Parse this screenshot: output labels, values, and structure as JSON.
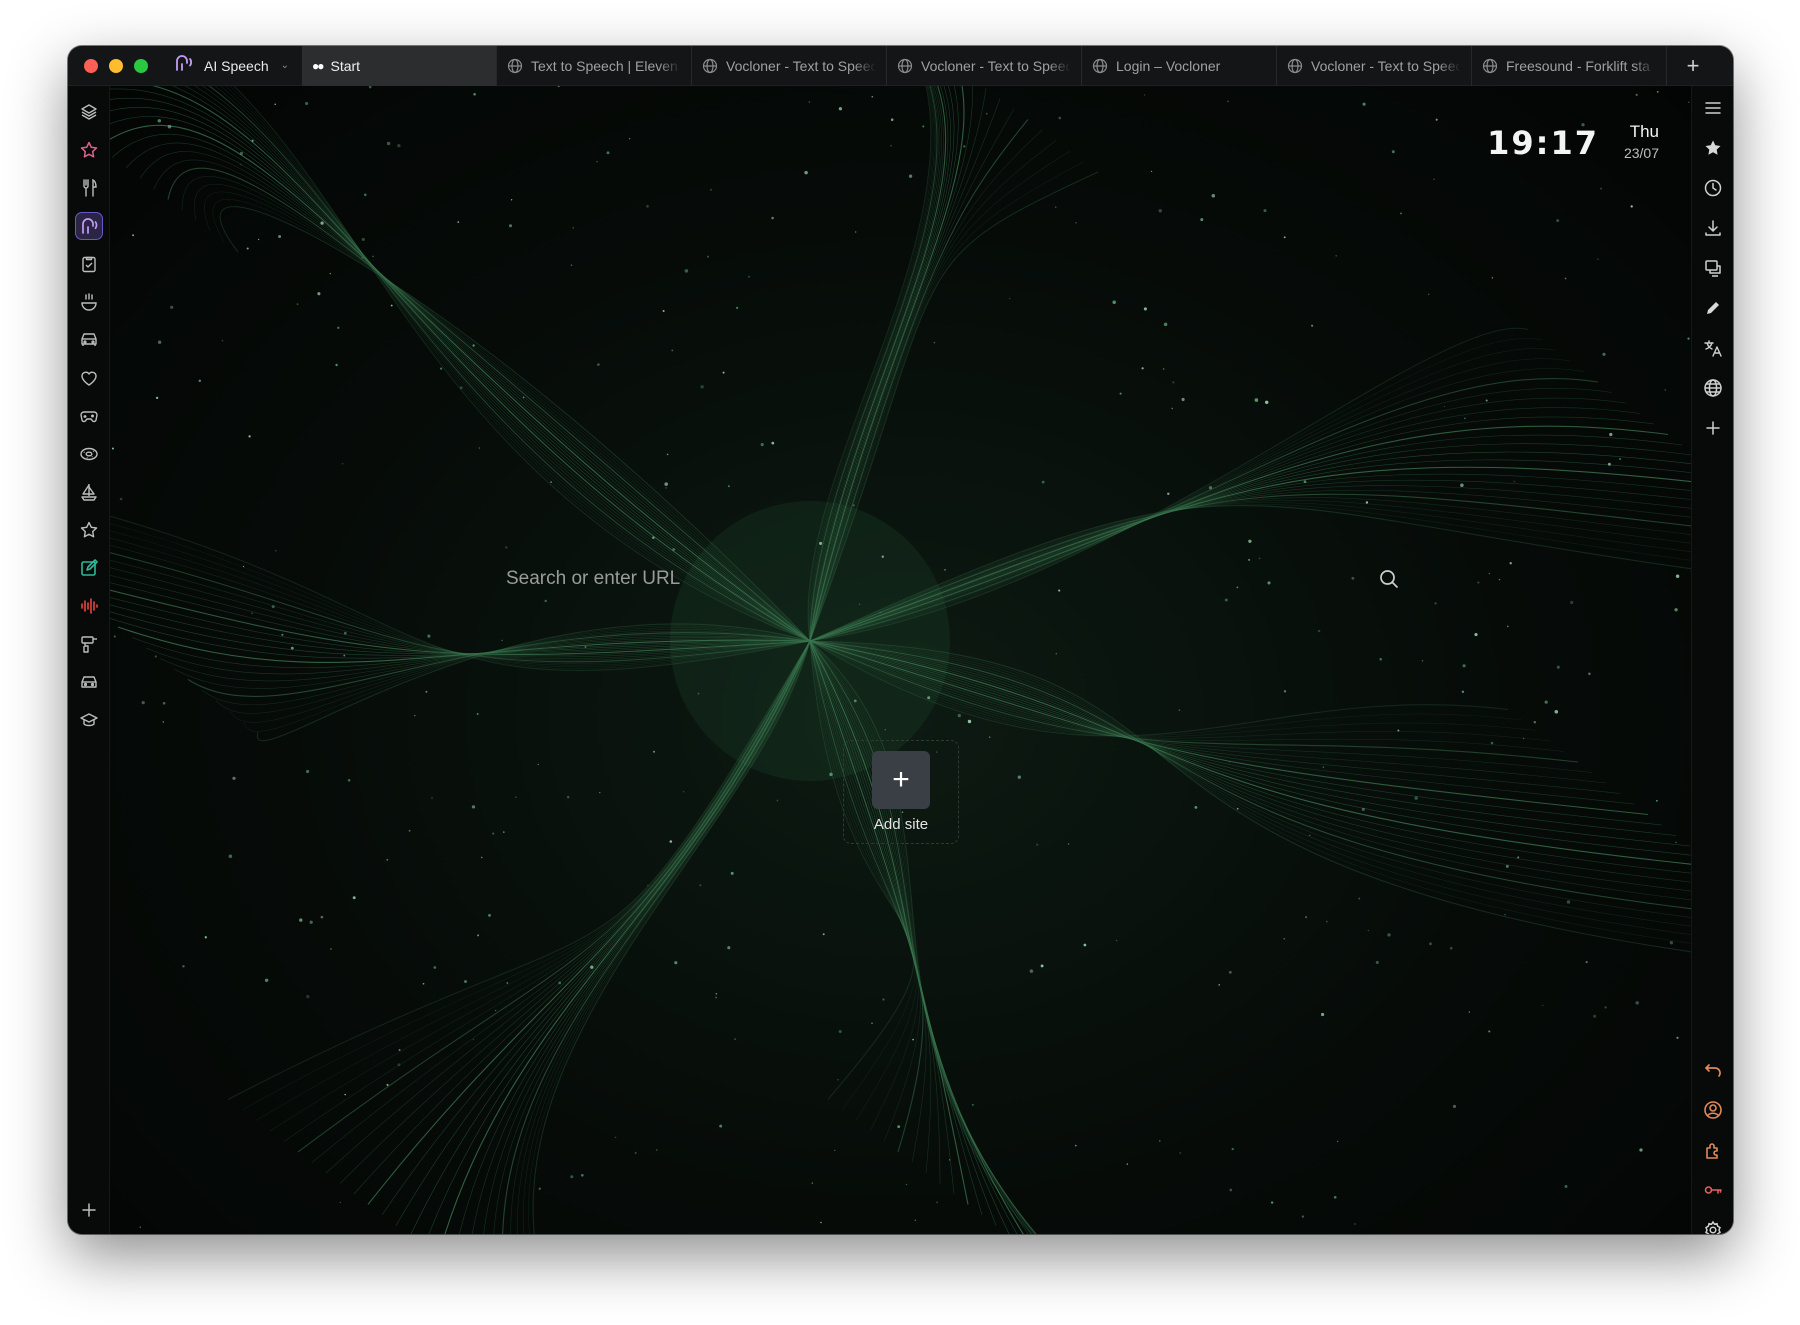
{
  "workspace": {
    "name": "AI Speech"
  },
  "tabs": [
    {
      "label": "Start",
      "active": true,
      "icon": "mask-icon"
    },
    {
      "label": "Text to Speech | Eleven",
      "icon": "globe-icon"
    },
    {
      "label": "Vocloner - Text to Speech",
      "icon": "globe-icon"
    },
    {
      "label": "Vocloner - Text to Speech",
      "icon": "globe-icon"
    },
    {
      "label": "Login – Vocloner",
      "icon": "globe-icon"
    },
    {
      "label": "Vocloner - Text to Speech",
      "icon": "globe-icon"
    },
    {
      "label": "Freesound - Forklift sta",
      "icon": "globe-icon"
    }
  ],
  "clock": {
    "time": "19:17",
    "day": "Thu",
    "date": "23/07"
  },
  "search": {
    "placeholder": "Search or enter URL"
  },
  "speed_dial": {
    "add_label": "Add site"
  },
  "left_sidebar": [
    "layers-icon",
    "star-icon",
    "cutlery-icon",
    "ai-speech-icon",
    "clipboard-check-icon",
    "steaming-bowl-icon",
    "car-icon",
    "heart-icon",
    "gamepad-icon",
    "donut-icon",
    "sailboat-icon",
    "star-outline-icon",
    "edit-square-icon",
    "audio-wave-icon",
    "drill-icon",
    "car-front-icon",
    "graduation-cap-icon",
    "add-panel-icon"
  ],
  "right_sidebar": [
    "menu-icon",
    "bookmark-star-icon",
    "history-icon",
    "download-icon",
    "snapshot-icon",
    "pencil-icon",
    "translate-icon",
    "globe-icon",
    "add-icon",
    "undo-icon",
    "account-icon",
    "extensions-icon",
    "key-icon",
    "settings-icon"
  ],
  "colors": {
    "accent_purple": "#c59cf5",
    "accent_green": "#2fb89a",
    "accent_red": "#e8453c",
    "accent_orange": "#e08a5a",
    "pink_star": "#e0608a"
  }
}
